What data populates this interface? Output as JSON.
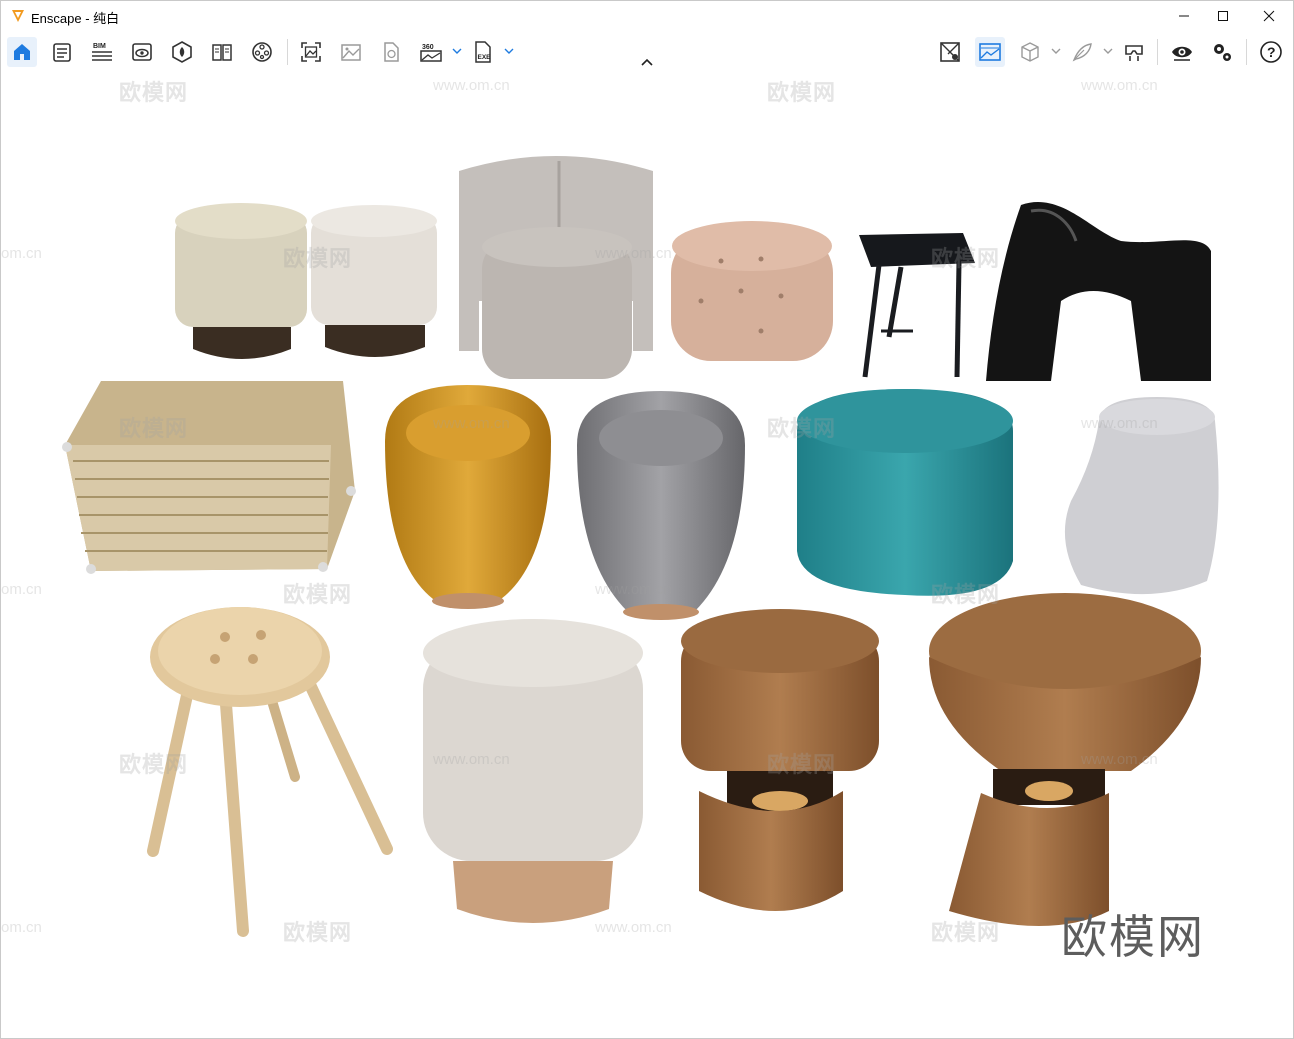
{
  "window": {
    "title": "Enscape - 纯白",
    "controls": {
      "minimize": "—",
      "maximize": "☐",
      "close": "✕"
    }
  },
  "toolbar": {
    "left_items": [
      {
        "name": "home-icon",
        "active": true
      },
      {
        "name": "visual-settings-icon"
      },
      {
        "name": "bim-icon",
        "label": "BIM"
      },
      {
        "name": "view-management-icon"
      },
      {
        "name": "asset-library-icon"
      },
      {
        "name": "material-editor-icon"
      },
      {
        "name": "video-editor-icon"
      },
      {
        "name": "screenshot-icon"
      },
      {
        "name": "batch-render-icon"
      },
      {
        "name": "export-web-icon"
      },
      {
        "name": "panorama-360-icon",
        "label": "360"
      },
      {
        "name": "export-exe-icon",
        "label": "EXE"
      }
    ],
    "right_items": [
      {
        "name": "sync-views-icon"
      },
      {
        "name": "atmosphere-icon"
      },
      {
        "name": "cube-icon"
      },
      {
        "name": "feather-icon"
      },
      {
        "name": "vr-headset-icon"
      },
      {
        "name": "preview-eye-icon"
      },
      {
        "name": "settings-gears-icon"
      },
      {
        "name": "help-icon",
        "label": "?"
      }
    ]
  },
  "viewport": {
    "watermark_text": "欧模网",
    "watermark_url": "www.om.cn",
    "watermark_url_partial": "om.cn",
    "brand_text": "欧模网"
  }
}
